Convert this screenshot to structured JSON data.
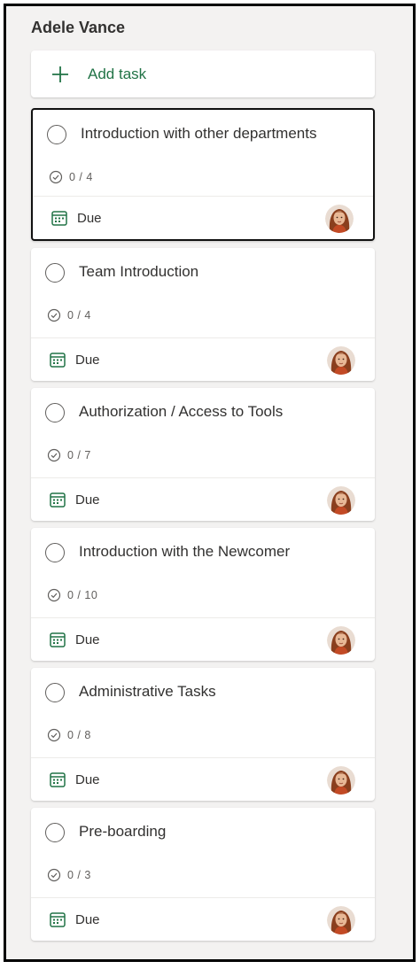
{
  "bucket": {
    "title": "Adele Vance",
    "add_task_label": "Add task"
  },
  "tasks": [
    {
      "title": "Introduction with other departments",
      "checklist": "0 / 4",
      "due_label": "Due",
      "selected": true
    },
    {
      "title": "Team Introduction",
      "checklist": "0 / 4",
      "due_label": "Due",
      "selected": false
    },
    {
      "title": "Authorization / Access to Tools",
      "checklist": "0 / 7",
      "due_label": "Due",
      "selected": false
    },
    {
      "title": "Introduction with the Newcomer",
      "checklist": "0 / 10",
      "due_label": "Due",
      "selected": false
    },
    {
      "title": "Administrative Tasks",
      "checklist": "0 / 8",
      "due_label": "Due",
      "selected": false
    },
    {
      "title": "Pre-boarding",
      "checklist": "0 / 3",
      "due_label": "Due",
      "selected": false
    }
  ],
  "icons": {
    "add": "plus-icon",
    "complete": "circle-icon",
    "checklist": "checklist-icon",
    "due": "calendar-icon",
    "assignee": "avatar"
  },
  "colors": {
    "accent_green": "#217346",
    "text": "#323130",
    "background": "#f3f2f1"
  }
}
